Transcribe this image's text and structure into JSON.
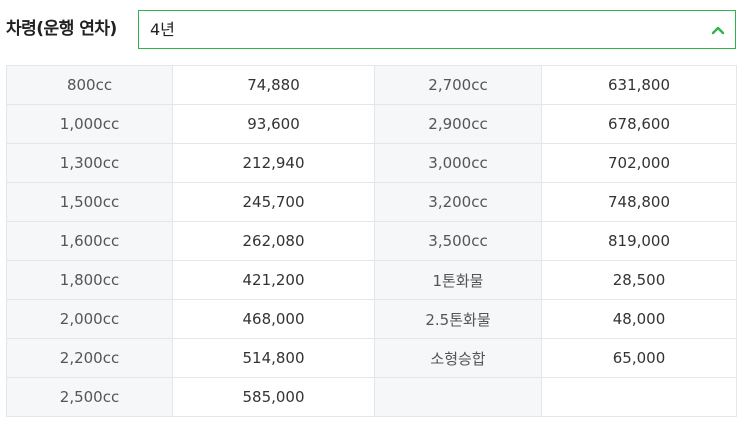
{
  "filter": {
    "label": "차령(운행 연차)",
    "selected": "4년",
    "icon": "chevron-up-icon",
    "accent_color": "#2fb34a"
  },
  "table": {
    "rows": [
      {
        "left_key": "800cc",
        "left_value": "74,880",
        "right_key": "2,700cc",
        "right_value": "631,800"
      },
      {
        "left_key": "1,000cc",
        "left_value": "93,600",
        "right_key": "2,900cc",
        "right_value": "678,600"
      },
      {
        "left_key": "1,300cc",
        "left_value": "212,940",
        "right_key": "3,000cc",
        "right_value": "702,000"
      },
      {
        "left_key": "1,500cc",
        "left_value": "245,700",
        "right_key": "3,200cc",
        "right_value": "748,800"
      },
      {
        "left_key": "1,600cc",
        "left_value": "262,080",
        "right_key": "3,500cc",
        "right_value": "819,000"
      },
      {
        "left_key": "1,800cc",
        "left_value": "421,200",
        "right_key": "1톤화물",
        "right_value": "28,500"
      },
      {
        "left_key": "2,000cc",
        "left_value": "468,000",
        "right_key": "2.5톤화물",
        "right_value": "48,000"
      },
      {
        "left_key": "2,200cc",
        "left_value": "514,800",
        "right_key": "소형승합",
        "right_value": "65,000"
      },
      {
        "left_key": "2,500cc",
        "left_value": "585,000",
        "right_key": "",
        "right_value": ""
      }
    ]
  }
}
